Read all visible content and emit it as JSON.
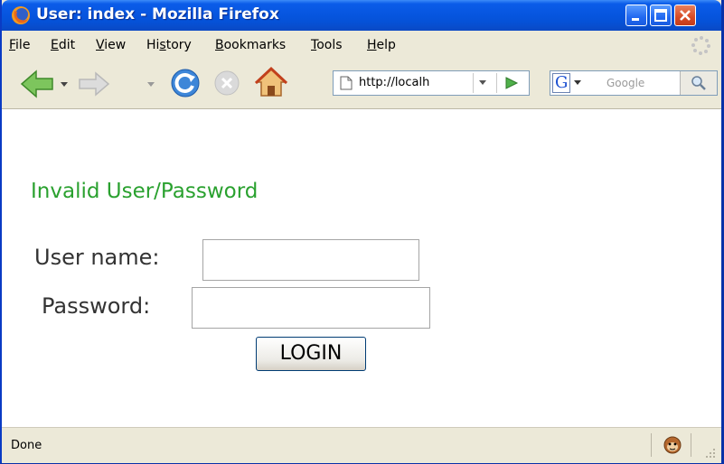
{
  "window": {
    "title": "User: index - Mozilla Firefox"
  },
  "menu": {
    "items": [
      {
        "pre": "",
        "ul": "F",
        "post": "ile"
      },
      {
        "pre": "",
        "ul": "E",
        "post": "dit"
      },
      {
        "pre": "",
        "ul": "V",
        "post": "iew"
      },
      {
        "pre": "Hi",
        "ul": "s",
        "post": "tory"
      },
      {
        "pre": "",
        "ul": "B",
        "post": "ookmarks"
      },
      {
        "pre": "",
        "ul": "T",
        "post": "ools"
      },
      {
        "pre": "",
        "ul": "H",
        "post": "elp"
      }
    ]
  },
  "navbar": {
    "url": "http://localh",
    "search_placeholder": "Google",
    "search_engine_letter": "G"
  },
  "page": {
    "error_message": "Invalid User/Password",
    "username_label": "User name:",
    "username_value": "",
    "password_label": "Password:",
    "password_value": "",
    "login_label": "LOGIN"
  },
  "status": {
    "text": "Done"
  }
}
